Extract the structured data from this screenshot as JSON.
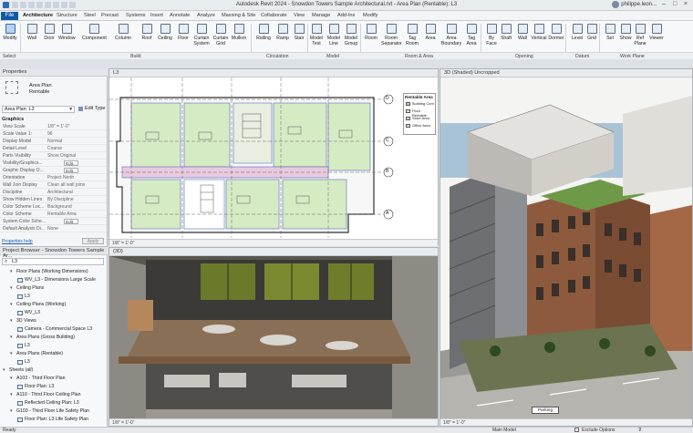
{
  "window": {
    "title": "Autodesk Revit 2024 - Snowdon Towers Sample Architectural.rvt - Area Plan (Rentable): L3",
    "user": "philippe.leon..."
  },
  "ribbon_tabs": [
    "File",
    "Architecture",
    "Structure",
    "Steel",
    "Precast",
    "Systems",
    "Insert",
    "Annotate",
    "Analyze",
    "Massing & Site",
    "Collaborate",
    "View",
    "Manage",
    "Add-Ins",
    "Modify"
  ],
  "ribbon_buttons": [
    "Modify",
    "Wall",
    "Door",
    "Window",
    "Component",
    "Column",
    "Roof",
    "Ceiling",
    "Floor",
    "Curtain System",
    "Curtain Grid",
    "Mullion",
    "Railing",
    "Ramp",
    "Stair",
    "Model Text",
    "Model Line",
    "Model Group",
    "Room",
    "Room Separator",
    "Tag Room",
    "Area",
    "Area Boundary",
    "Tag Area",
    "By Face",
    "Shaft",
    "Wall",
    "Vertical",
    "Dormer",
    "Level",
    "Grid",
    "Set",
    "Show",
    "Ref Plane",
    "Viewer"
  ],
  "ribbon_panels": [
    "Select",
    "Build",
    "Circulation",
    "Model",
    "Room & Area",
    "Opening",
    "Datum",
    "Work Plane"
  ],
  "properties": {
    "header": "Properties",
    "type_name": "Area Plan",
    "type_sub": "Rentable",
    "selector": "Area Plan: L3",
    "edit_type": "Edit Type",
    "section": "Graphics",
    "rows": [
      {
        "k": "View Scale",
        "v": "1/8\" = 1'-0\""
      },
      {
        "k": "Scale Value 1:",
        "v": "96"
      },
      {
        "k": "Display Model",
        "v": "Normal"
      },
      {
        "k": "Detail Level",
        "v": "Coarse"
      },
      {
        "k": "Parts Visibility",
        "v": "Show Original"
      },
      {
        "k": "Visibility/Graphics...",
        "v": "Edit..."
      },
      {
        "k": "Graphic Display O...",
        "v": "Edit..."
      },
      {
        "k": "Orientation",
        "v": "Project North"
      },
      {
        "k": "Wall Join Display",
        "v": "Clean all wall joins"
      },
      {
        "k": "Discipline",
        "v": "Architectural"
      },
      {
        "k": "Show Hidden Lines",
        "v": "By Discipline"
      },
      {
        "k": "Color Scheme Loc...",
        "v": "Background"
      },
      {
        "k": "Color Scheme",
        "v": "Rentable Area"
      },
      {
        "k": "System Color Sche...",
        "v": "Edit..."
      },
      {
        "k": "Default Analysis Di...",
        "v": "None"
      }
    ],
    "help_link": "Properties help",
    "apply": "Apply"
  },
  "browser": {
    "header": "Project Browser - Snowdon Towers Sample Ar...",
    "search": "L3",
    "items": [
      {
        "label": "Floor Plans (Working Dimensions)",
        "indent": 1,
        "icon": false
      },
      {
        "label": "WV_L3 - Dimensions Large Scale",
        "indent": 2,
        "icon": true
      },
      {
        "label": "Ceiling Plans",
        "indent": 1,
        "icon": false
      },
      {
        "label": "L3",
        "indent": 2,
        "icon": true
      },
      {
        "label": "Ceiling Plans (Working)",
        "indent": 1,
        "icon": false
      },
      {
        "label": "WV_L3",
        "indent": 2,
        "icon": true
      },
      {
        "label": "3D Views",
        "indent": 1,
        "icon": false
      },
      {
        "label": "Camera - Commercial Space L3",
        "indent": 2,
        "icon": true
      },
      {
        "label": "Area Plans (Gross Building)",
        "indent": 1,
        "icon": false
      },
      {
        "label": "L3",
        "indent": 2,
        "icon": true
      },
      {
        "label": "Area Plans (Rentable)",
        "indent": 1,
        "icon": false
      },
      {
        "label": "L3",
        "indent": 2,
        "icon": true
      },
      {
        "label": "Sheets (all)",
        "indent": 0,
        "icon": false
      },
      {
        "label": "A103 - Third Floor Plan",
        "indent": 1,
        "icon": false
      },
      {
        "label": "Floor Plan: L3",
        "indent": 2,
        "icon": true
      },
      {
        "label": "A110 - Third Floor Ceiling Plan",
        "indent": 1,
        "icon": false
      },
      {
        "label": "Reflected Ceiling Plan: L3",
        "indent": 2,
        "icon": true
      },
      {
        "label": "G103 - Third Floor Life Safety Plan",
        "indent": 1,
        "icon": false
      },
      {
        "label": "Floor Plan: L3 Life Safety Plan",
        "indent": 2,
        "icon": true
      }
    ]
  },
  "views": {
    "plan_tab": "L3",
    "plan_scale": "1/8\" = 1'-0\"",
    "plan_legend_title": "Rentable Area",
    "plan_legend": [
      "Building Com",
      "Floor Rentable",
      "Store Area",
      "Office Area"
    ],
    "camera_tab": "{3D}",
    "camera_scale": "1/8\" = 1'-0\"",
    "shaded_tab": "3D (Shaded) Uncropped",
    "shaded_scale": "1/8\" = 1'-0\"",
    "grid_labels": [
      "D",
      "C",
      "B",
      "A"
    ],
    "sign": "Parking"
  },
  "statusbar": {
    "left": "Ready",
    "model": "Main Model",
    "exclude": "Exclude Options"
  },
  "colors": {
    "accent": "#0e5aa7",
    "area_green": "#d5ebc4",
    "corridor_pink": "#e9c9dd"
  }
}
